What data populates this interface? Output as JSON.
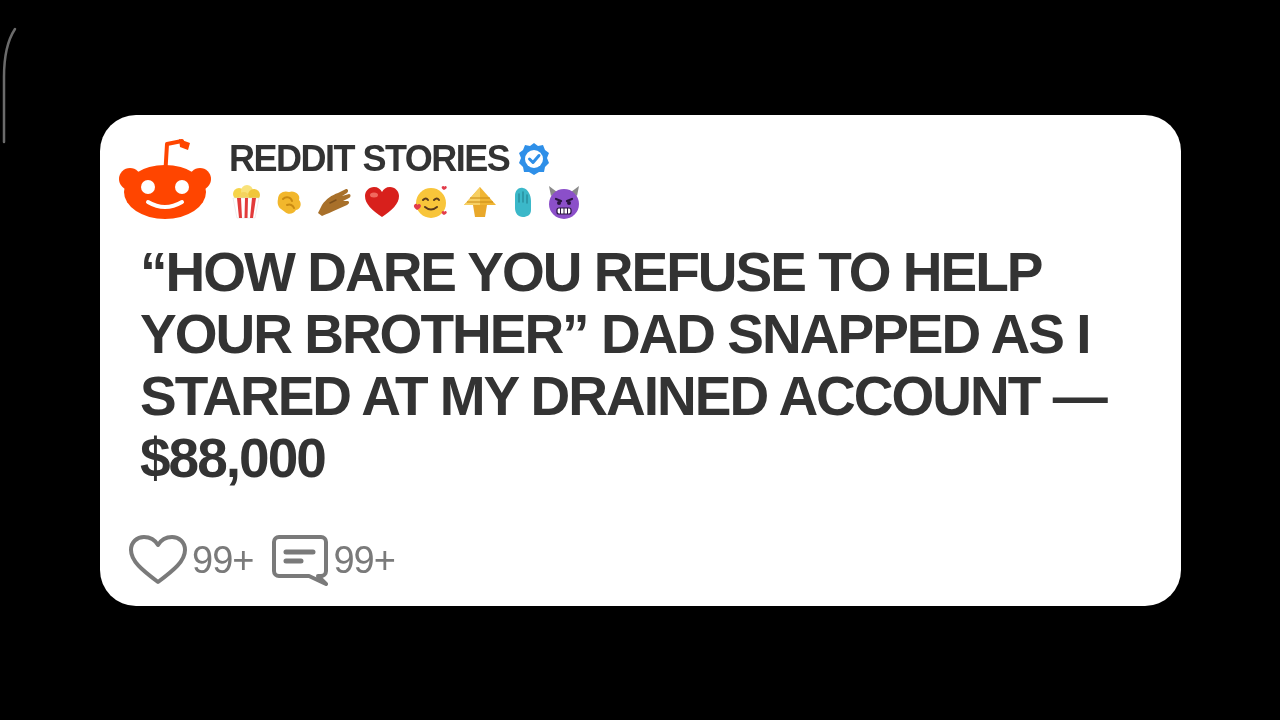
{
  "channel": {
    "name": "REDDIT STORIES",
    "verified": true
  },
  "post": {
    "title": "“HOW DARE YOU REFUSE TO HELP YOUR BROTHER” DAD SNAPPED AS I STARED AT MY DRAINED ACCOUNT — $88,000"
  },
  "stats": {
    "likes": "99+",
    "comments": "99+"
  }
}
